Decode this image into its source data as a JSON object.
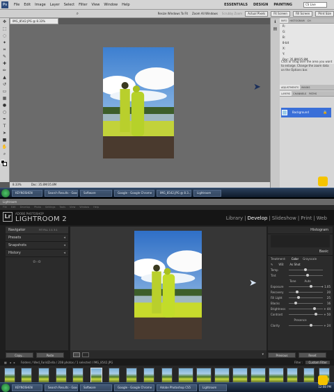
{
  "photoshop": {
    "logo": "Ps",
    "menu": [
      "File",
      "Edit",
      "Image",
      "Layer",
      "Select",
      "Filter",
      "View",
      "Window",
      "Help"
    ],
    "workspaces": [
      "ESSENTIALS",
      "DESIGN",
      "PAINTING"
    ],
    "cs_live": "CS Live",
    "options": {
      "resize_windows": "Resize Windows To Fit",
      "zoom_all": "Zoom All Windows",
      "scrubby": "Scrubby Zoom",
      "actual_pixels": "Actual Pixels",
      "fit_screen": "Fit Screen",
      "fill_screen": "Fill Screen",
      "print_size": "Print Size"
    },
    "doc_tab": "IMG_8542.JPG @ 8.33% (RGB/8*)",
    "status": {
      "zoom": "8.33%",
      "doc": "Doc: 35.8M/35.8M"
    },
    "panel_tabs_top": [
      "INFO",
      "HISTOGRAM",
      "CH"
    ],
    "info_rows": [
      "R:",
      "G:",
      "B:",
      "8-bit",
      "X:",
      "Y:",
      "Doc: 35.8M/35.8M"
    ],
    "info_hint": "Click or drag over the area you want to enlarge. Change the zoom data on the Options bar.",
    "panel_tabs_mid": [
      "ADJUSTMENTS",
      "MASKS"
    ],
    "panel_tabs_layers": [
      "LAYERS",
      "CHANNELS",
      "PATHS"
    ],
    "layer_name": "Background"
  },
  "taskbar_top": {
    "items": [
      "KEYNOSHEN",
      "Search Results - Goog...",
      "Software",
      "Google - Google Chrome",
      "IMG_8542.JPG @ 8.3...",
      "Lightroom"
    ]
  },
  "lightroom": {
    "window_title": "Lightroom",
    "menu": [
      "File",
      "Edit",
      "Develop",
      "Photo",
      "Settings",
      "Tools",
      "View",
      "Window",
      "Help"
    ],
    "brand_line1": "ADOBE PHOTOSHOP",
    "brand_line2": "LIGHTROOM 2",
    "modules": [
      "Library",
      "Develop",
      "Slideshow",
      "Print",
      "Web"
    ],
    "active_module": "Develop",
    "left_panels": [
      "Navigator",
      "Presets",
      "Snapshots",
      "History"
    ],
    "nav_zoom": "FIT  FILL  1:1  3:1",
    "right_title": "Histogram",
    "basic": "Basic",
    "treatment": {
      "label": "Treatment:",
      "color": "Color",
      "gray": "Grayscale"
    },
    "wb": {
      "label": "WB:",
      "value": "As Shot"
    },
    "temp": "Temp",
    "tint": "Tint",
    "tone": "Tone",
    "auto": "Auto",
    "sliders": [
      {
        "name": "Exposure",
        "value": "+ 1.05"
      },
      {
        "name": "Recovery",
        "value": "20"
      },
      {
        "name": "Fill Light",
        "value": "25"
      },
      {
        "name": "Blacks",
        "value": "16"
      },
      {
        "name": "Brightness",
        "value": "+ 44"
      },
      {
        "name": "Contrast",
        "value": "+ 50"
      }
    ],
    "presence": "Presence",
    "clarity": {
      "name": "Clarity",
      "value": "+ 24"
    },
    "copy": "Copy...",
    "paste": "Paste",
    "previous": "Previous",
    "reset": "Reset",
    "filmstrip_path": "Folders / Wed_FaridZiella / 208 photos / 1 selected / IMG_8542.JPG",
    "filter_label": "Filter :",
    "filter_value": "Custom Filter"
  },
  "taskbar_bottom": {
    "items": [
      "KEYNOSHEN",
      "Search Results - Goog...",
      "Software",
      "Google - Google Chrome",
      "Adobe Photoshop CS5",
      "Lightroom"
    ],
    "clock": "12:08 PM"
  },
  "colors": {
    "ps_bg": "#595959",
    "lr_bg": "#1e1e1e",
    "layer_selected": "#3a6fd8"
  }
}
